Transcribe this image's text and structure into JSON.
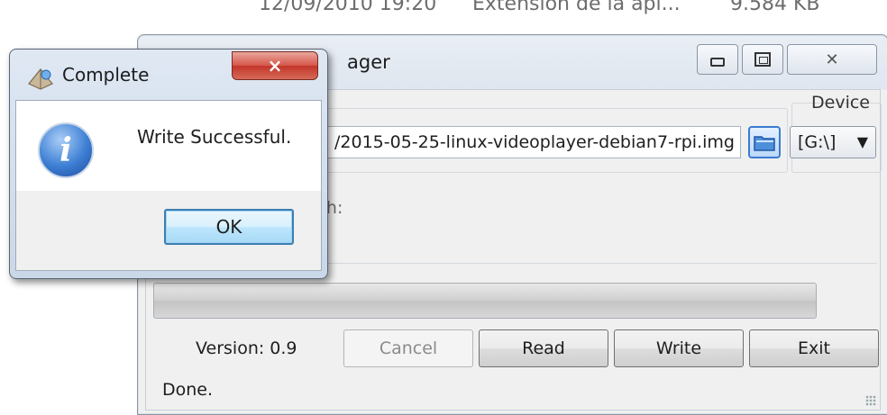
{
  "background": {
    "date": "12/09/2010 19:20",
    "type": "Extensión de la apl...",
    "size": "9.584 KB"
  },
  "main_window": {
    "title_fragment": "ager",
    "device_label": "Device",
    "image_path": "/2015-05-25-linux-videoplayer-debian7-rpi.img",
    "device_value": "[G:\\]",
    "hash_label_fragment": "sh:",
    "progress_percent": 0,
    "version_text": "Version: 0.9",
    "cancel_label": "Cancel",
    "read_label": "Read",
    "write_label": "Write",
    "exit_label": "Exit",
    "status_text": "Done."
  },
  "dialog": {
    "title": "Complete",
    "close_glyph": "×",
    "message": "Write Successful.",
    "info_glyph": "i",
    "ok_label": "OK"
  }
}
